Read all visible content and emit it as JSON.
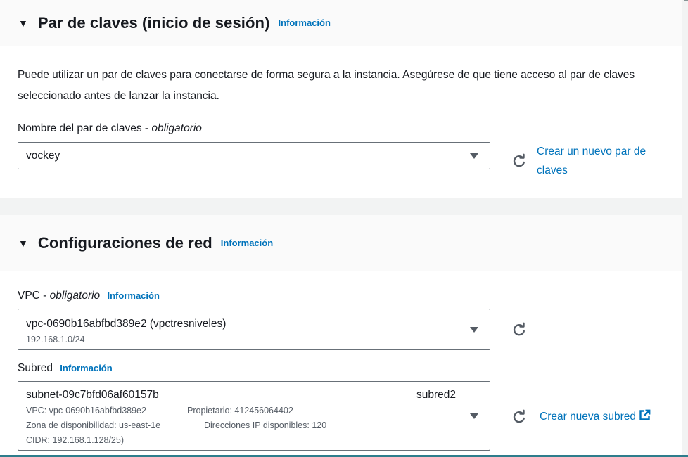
{
  "keypair": {
    "title": "Par de claves (inicio de sesión)",
    "info": "Información",
    "description": "Puede utilizar un par de claves para conectarse de forma segura a la instancia. Asegúrese de que tiene acceso al par de claves seleccionado antes de lanzar la instancia.",
    "label_main": "Nombre del par de claves - ",
    "label_required": "obligatorio",
    "selected": "vockey",
    "create_link": "Crear un nuevo par de claves"
  },
  "network": {
    "title": "Configuraciones de red",
    "info": "Información",
    "vpc": {
      "label_main": "VPC - ",
      "label_required": "obligatorio",
      "info": "Información",
      "selected": "vpc-0690b16abfbd389e2 (vpctresniveles)",
      "cidr": "192.168.1.0/24"
    },
    "subnet": {
      "label": "Subred",
      "info": "Información",
      "selected": "subnet-09c7bfd06af60157b",
      "name_tag": "subred2",
      "detail_vpc": "VPC: vpc-0690b16abfbd389e2",
      "detail_owner": "Propietario: 412456064402",
      "detail_az": "Zona de disponibilidad: us-east-1e",
      "detail_ips": "Direcciones IP disponibles: 120",
      "detail_cidr": "CIDR: 192.168.1.128/25)",
      "create_link": "Crear nueva subred"
    }
  },
  "icons": {
    "caret": "caret-down-icon",
    "refresh": "refresh-icon",
    "external": "external-link-icon"
  },
  "colors": {
    "link": "#0073bb",
    "text": "#16191f",
    "muted": "#545b64",
    "border": "#687078"
  }
}
